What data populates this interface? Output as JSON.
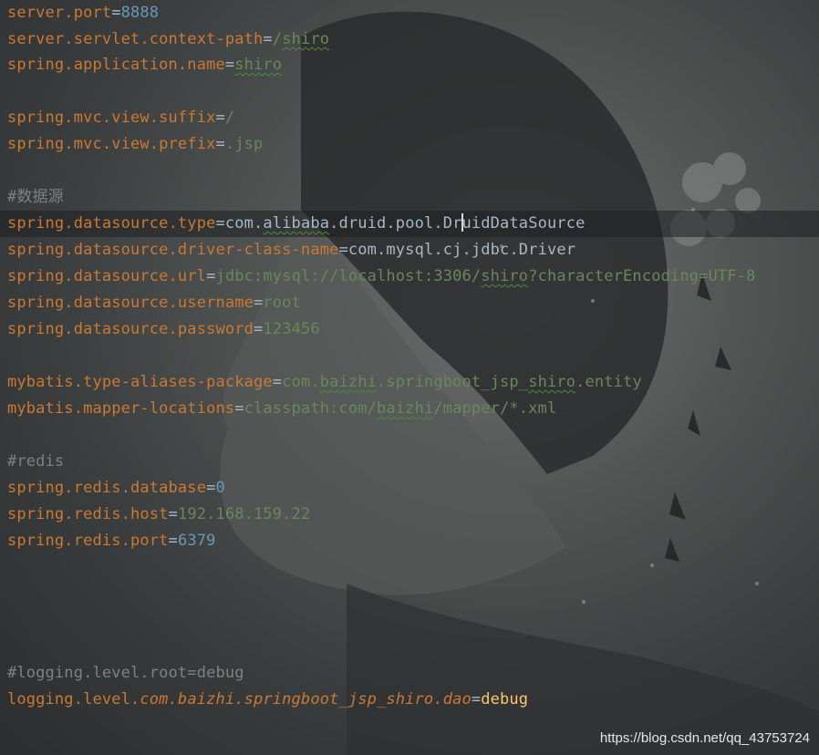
{
  "lines": {
    "l1": {
      "key": "server.port",
      "eq": "=",
      "val": "8888"
    },
    "l2": {
      "key": "server.servlet.context-path",
      "eq": "=",
      "val_a": "/",
      "val_b": "shiro"
    },
    "l3": {
      "key": "spring.application.name",
      "eq": "=",
      "val": "shiro"
    },
    "l4": {
      "key": "spring.mvc.view.suffix",
      "eq": "=",
      "val": "/"
    },
    "l5": {
      "key": "spring.mvc.view.prefix",
      "eq": "=",
      "val": ".jsp"
    },
    "l6": {
      "comment": "#数据源"
    },
    "l7": {
      "key": "spring.datasource.type",
      "eq": "=",
      "v1": "com.",
      "v2": "alibaba",
      "v3": ".druid.pool.Dr",
      "v4": "uidDataSource"
    },
    "l8": {
      "key": "spring.datasource.driver-class-name",
      "eq": "=",
      "val": "com.mysql.cj.jdbc.Driver"
    },
    "l9": {
      "key": "spring.datasource.url",
      "eq": "=",
      "v1": "jdbc:mysql://localhost:3306/",
      "v2": "shiro",
      "v3": "?characterEncoding=UTF-8"
    },
    "l10": {
      "key": "spring.datasource.username",
      "eq": "=",
      "val": "root"
    },
    "l11": {
      "key": "spring.datasource.password",
      "eq": "=",
      "val": "123456"
    },
    "l12": {
      "key": "mybatis.type-aliases-package",
      "eq": "=",
      "v1": "com.",
      "v2": "baizhi",
      "v3": ".springboot_jsp_",
      "v4": "shiro",
      "v5": ".entity"
    },
    "l13": {
      "key": "mybatis.mapper-locations",
      "eq": "=",
      "v1": "classpath:com/",
      "v2": "baizhi",
      "v3": "/mapper/*.xml"
    },
    "l14": {
      "comment": "#redis"
    },
    "l15": {
      "key": "spring.redis.database",
      "eq": "=",
      "val": "0"
    },
    "l16": {
      "key": "spring.redis.host",
      "eq": "=",
      "val": "192.168.159.22"
    },
    "l17": {
      "key": "spring.redis.port",
      "eq": "=",
      "val": "6379"
    },
    "l18": {
      "comment": "#logging.level.root=debug"
    },
    "l19": {
      "key": "logging.level.",
      "pkg": "com.baizhi.springboot_jsp_shiro.dao",
      "eq": "=",
      "val": "debug"
    }
  },
  "watermark": "https://blog.csdn.net/qq_43753724",
  "colors": {
    "key": "#cc7832",
    "value": "#6a8759",
    "number": "#6897bb",
    "comment": "#808080",
    "highlight": "#ffc66d",
    "class_value": "#a9b7c6"
  }
}
